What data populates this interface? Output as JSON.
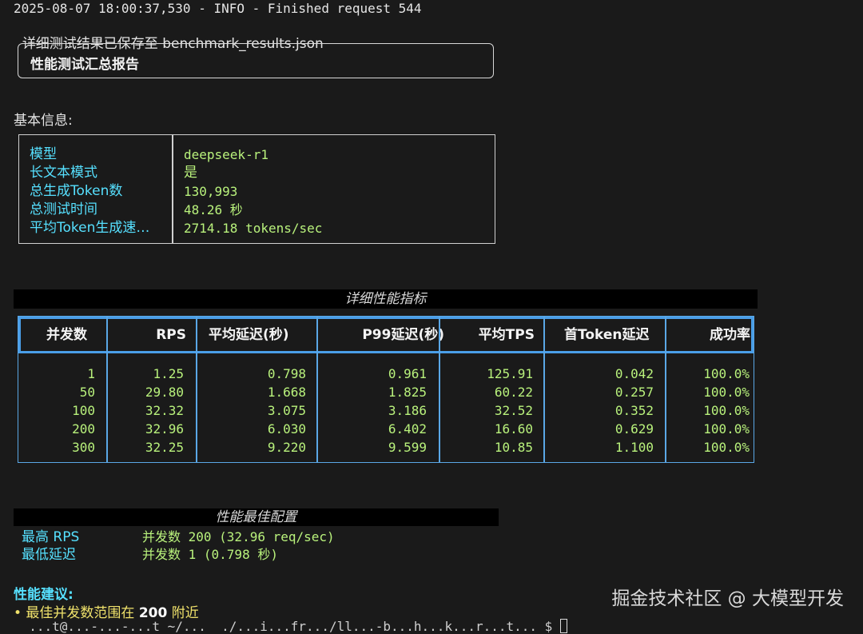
{
  "log": {
    "line1": "2025-08-07 18:00:37,530 - INFO - Finished request 544",
    "line2": "详细测试结果已保存至 benchmark_results.json"
  },
  "report": {
    "title": "性能测试汇总报告"
  },
  "basic_info": {
    "heading": "基本信息:",
    "rows": [
      {
        "key": "模型",
        "value": "deepseek-r1"
      },
      {
        "key": "长文本模式",
        "value": "是"
      },
      {
        "key": "总生成Token数",
        "value": "130,993"
      },
      {
        "key": "总测试时间",
        "value": "48.26 秒"
      },
      {
        "key": "平均Token生成速…",
        "value": "2714.18 tokens/sec"
      }
    ]
  },
  "metrics": {
    "title": "详细性能指标",
    "headers": [
      "并发数",
      "RPS",
      "平均延迟(秒)",
      "P99延迟(秒)",
      "平均TPS",
      "首Token延迟",
      "成功率"
    ],
    "rows": [
      [
        "1",
        "1.25",
        "0.798",
        "0.961",
        "125.91",
        "0.042",
        "100.0%"
      ],
      [
        "50",
        "29.80",
        "1.668",
        "1.825",
        "60.22",
        "0.257",
        "100.0%"
      ],
      [
        "100",
        "32.32",
        "3.075",
        "3.186",
        "32.52",
        "0.352",
        "100.0%"
      ],
      [
        "200",
        "32.96",
        "6.030",
        "6.402",
        "16.60",
        "0.629",
        "100.0%"
      ],
      [
        "300",
        "32.25",
        "9.220",
        "9.599",
        "10.85",
        "1.100",
        "100.0%"
      ]
    ]
  },
  "best_config": {
    "title": "性能最佳配置",
    "items": [
      {
        "key": "最高 RPS",
        "value": "并发数 200 (32.96 req/sec)"
      },
      {
        "key": "最低延迟",
        "value": "并发数 1 (0.798 秒)"
      }
    ]
  },
  "advice": {
    "title": "性能建议:",
    "bullet_prefix": "• 最佳并发数范围在 ",
    "bullet_value": "200",
    "bullet_suffix": " 附近",
    "prompt_fragment": "  ...t@...-...-...t ~/...  ./...i...fr.../ll...-b...h...k...r...t... $ "
  },
  "watermark": "掘金技术社区 @ 大模型开发",
  "colors": {
    "background": "#1a1a1a",
    "key_cyan": "#56e0ff",
    "value_green": "#b9f27c",
    "table_blue": "#4a9ee8",
    "bullet_yellow": "#f0e26b"
  }
}
